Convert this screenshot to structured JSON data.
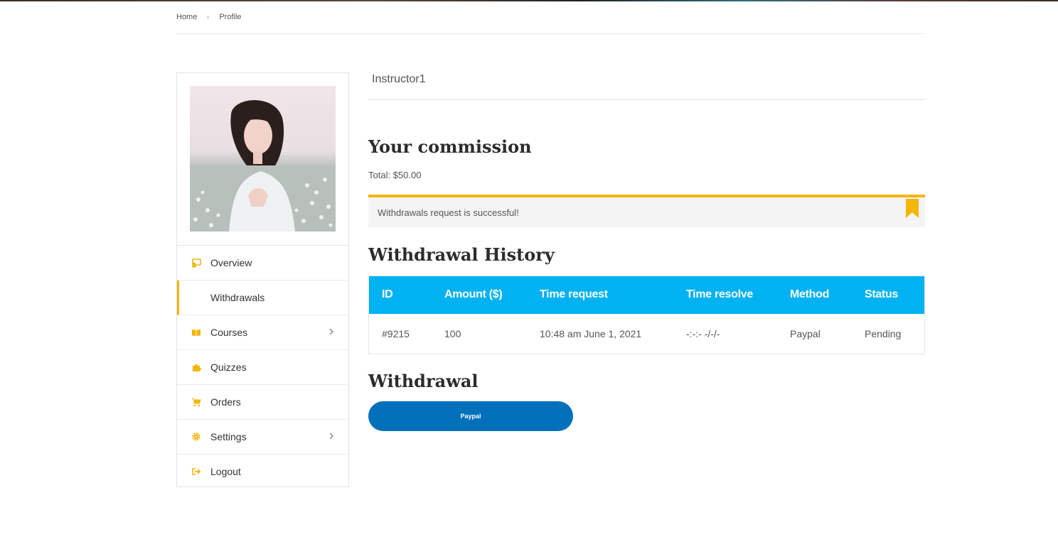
{
  "breadcrumb": {
    "home": "Home",
    "current": "Profile"
  },
  "sidebar": {
    "items": [
      {
        "label": "Overview",
        "icon": "overview-icon"
      },
      {
        "label": "Withdrawals",
        "icon": "",
        "active": true
      },
      {
        "label": "Courses",
        "icon": "book-icon",
        "submenu": true
      },
      {
        "label": "Quizzes",
        "icon": "puzzle-icon"
      },
      {
        "label": "Orders",
        "icon": "cart-icon"
      },
      {
        "label": "Settings",
        "icon": "gear-icon",
        "submenu": true
      },
      {
        "label": "Logout",
        "icon": "logout-icon"
      }
    ]
  },
  "main": {
    "username": "Instructor1",
    "commission_title": "Your commission",
    "total": "Total: $50.00",
    "alert": "Withdrawals request is successful!",
    "history_title": "Withdrawal History",
    "table": {
      "headers": [
        "ID",
        "Amount ($)",
        "Time request",
        "Time resolve",
        "Method",
        "Status"
      ],
      "rows": [
        [
          "#9215",
          "100",
          "10:48 am June 1, 2021",
          "-:-:- -/-/-",
          "Paypal",
          "Pending"
        ]
      ]
    },
    "withdraw_title": "Withdrawal",
    "paypal_label": "Paypal"
  },
  "colors": {
    "accent": "#f5b50a",
    "table_header": "#00b2f2",
    "paypal": "#0070ba"
  }
}
